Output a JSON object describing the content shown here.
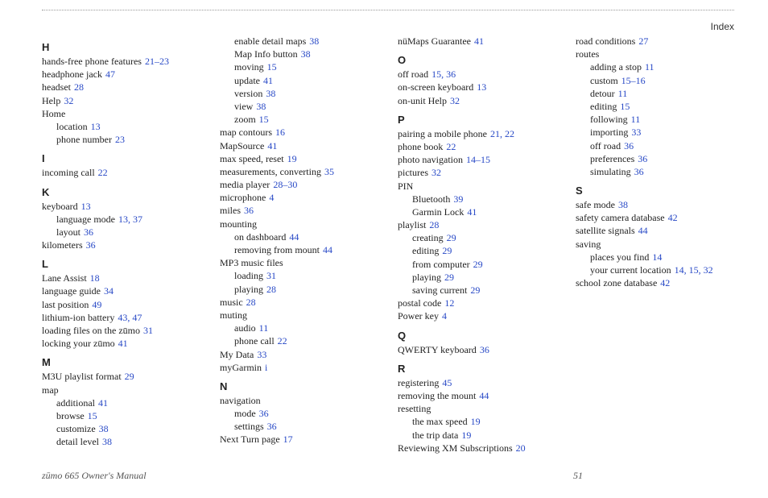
{
  "header": {
    "label": "Index"
  },
  "footer": {
    "left": "zūmo 665 Owner's Manual",
    "page_number": "51"
  },
  "index": [
    {
      "type": "letter",
      "text": "H"
    },
    {
      "type": "entry",
      "level": 0,
      "text": "hands-free phone features",
      "pages": "21–23"
    },
    {
      "type": "entry",
      "level": 0,
      "text": "headphone jack",
      "pages": "47"
    },
    {
      "type": "entry",
      "level": 0,
      "text": "headset",
      "pages": "28"
    },
    {
      "type": "entry",
      "level": 0,
      "text": "Help",
      "pages": "32"
    },
    {
      "type": "entry",
      "level": 0,
      "text": "Home",
      "pages": ""
    },
    {
      "type": "entry",
      "level": 1,
      "text": "location",
      "pages": "13"
    },
    {
      "type": "entry",
      "level": 1,
      "text": "phone number",
      "pages": "23"
    },
    {
      "type": "letter",
      "text": "I"
    },
    {
      "type": "entry",
      "level": 0,
      "text": "incoming call",
      "pages": "22"
    },
    {
      "type": "letter",
      "text": "K"
    },
    {
      "type": "entry",
      "level": 0,
      "text": "keyboard",
      "pages": "13"
    },
    {
      "type": "entry",
      "level": 1,
      "text": "language mode",
      "pages": "13, 37"
    },
    {
      "type": "entry",
      "level": 1,
      "text": "layout",
      "pages": "36"
    },
    {
      "type": "entry",
      "level": 0,
      "text": "kilometers",
      "pages": "36"
    },
    {
      "type": "letter",
      "text": "L"
    },
    {
      "type": "entry",
      "level": 0,
      "text": "Lane Assist",
      "pages": "18"
    },
    {
      "type": "entry",
      "level": 0,
      "text": "language guide",
      "pages": "34"
    },
    {
      "type": "entry",
      "level": 0,
      "text": "last position",
      "pages": "49"
    },
    {
      "type": "entry",
      "level": 0,
      "text": "lithium-ion battery",
      "pages": "43, 47"
    },
    {
      "type": "entry",
      "level": 0,
      "text": "loading files on the zūmo",
      "pages": "31"
    },
    {
      "type": "entry",
      "level": 0,
      "text": "locking your zūmo",
      "pages": "41"
    },
    {
      "type": "letter",
      "text": "M"
    },
    {
      "type": "entry",
      "level": 0,
      "text": "M3U playlist format",
      "pages": "29"
    },
    {
      "type": "entry",
      "level": 0,
      "text": "map",
      "pages": ""
    },
    {
      "type": "entry",
      "level": 1,
      "text": "additional",
      "pages": "41"
    },
    {
      "type": "entry",
      "level": 1,
      "text": "browse",
      "pages": "15"
    },
    {
      "type": "entry",
      "level": 1,
      "text": "customize",
      "pages": "38"
    },
    {
      "type": "entry",
      "level": 1,
      "text": "detail level",
      "pages": "38"
    },
    {
      "type": "entry",
      "level": 1,
      "text": "enable detail maps",
      "pages": "38"
    },
    {
      "type": "entry",
      "level": 1,
      "text": "Map Info button",
      "pages": "38"
    },
    {
      "type": "entry",
      "level": 1,
      "text": "moving",
      "pages": "15"
    },
    {
      "type": "entry",
      "level": 1,
      "text": "update",
      "pages": "41"
    },
    {
      "type": "entry",
      "level": 1,
      "text": "version",
      "pages": "38"
    },
    {
      "type": "entry",
      "level": 1,
      "text": "view",
      "pages": "38"
    },
    {
      "type": "entry",
      "level": 1,
      "text": "zoom",
      "pages": "15"
    },
    {
      "type": "entry",
      "level": 0,
      "text": "map contours",
      "pages": "16"
    },
    {
      "type": "entry",
      "level": 0,
      "text": "MapSource",
      "pages": "41"
    },
    {
      "type": "entry",
      "level": 0,
      "text": "max speed, reset",
      "pages": "19"
    },
    {
      "type": "entry",
      "level": 0,
      "text": "measurements, converting",
      "pages": "35"
    },
    {
      "type": "entry",
      "level": 0,
      "text": "media player",
      "pages": "28–30"
    },
    {
      "type": "entry",
      "level": 0,
      "text": "microphone",
      "pages": "4"
    },
    {
      "type": "entry",
      "level": 0,
      "text": "miles",
      "pages": "36"
    },
    {
      "type": "entry",
      "level": 0,
      "text": "mounting",
      "pages": ""
    },
    {
      "type": "entry",
      "level": 1,
      "text": "on dashboard",
      "pages": "44"
    },
    {
      "type": "entry",
      "level": 1,
      "text": "removing from mount",
      "pages": "44"
    },
    {
      "type": "entry",
      "level": 0,
      "text": "MP3 music files",
      "pages": ""
    },
    {
      "type": "entry",
      "level": 1,
      "text": "loading",
      "pages": "31"
    },
    {
      "type": "entry",
      "level": 1,
      "text": "playing",
      "pages": "28"
    },
    {
      "type": "entry",
      "level": 0,
      "text": "music",
      "pages": "28"
    },
    {
      "type": "entry",
      "level": 0,
      "text": "muting",
      "pages": ""
    },
    {
      "type": "entry",
      "level": 1,
      "text": "audio",
      "pages": "11"
    },
    {
      "type": "entry",
      "level": 1,
      "text": "phone call",
      "pages": "22"
    },
    {
      "type": "entry",
      "level": 0,
      "text": "My Data",
      "pages": "33"
    },
    {
      "type": "entry",
      "level": 0,
      "text": "myGarmin",
      "pages": "i"
    },
    {
      "type": "letter",
      "text": "N"
    },
    {
      "type": "entry",
      "level": 0,
      "text": "navigation",
      "pages": ""
    },
    {
      "type": "entry",
      "level": 1,
      "text": "mode",
      "pages": "36"
    },
    {
      "type": "entry",
      "level": 1,
      "text": "settings",
      "pages": "36"
    },
    {
      "type": "entry",
      "level": 0,
      "text": "Next Turn page",
      "pages": "17"
    },
    {
      "type": "entry",
      "level": 0,
      "text": "nüMaps Guarantee",
      "pages": "41"
    },
    {
      "type": "letter",
      "text": "O"
    },
    {
      "type": "entry",
      "level": 0,
      "text": "off road",
      "pages": "15, 36"
    },
    {
      "type": "entry",
      "level": 0,
      "text": "on-screen keyboard",
      "pages": "13"
    },
    {
      "type": "entry",
      "level": 0,
      "text": "on-unit Help",
      "pages": "32"
    },
    {
      "type": "letter",
      "text": "P"
    },
    {
      "type": "entry",
      "level": 0,
      "text": "pairing a mobile phone",
      "pages": "21, 22"
    },
    {
      "type": "entry",
      "level": 0,
      "text": "phone book",
      "pages": "22"
    },
    {
      "type": "entry",
      "level": 0,
      "text": "photo navigation",
      "pages": "14–15"
    },
    {
      "type": "entry",
      "level": 0,
      "text": "pictures",
      "pages": "32"
    },
    {
      "type": "entry",
      "level": 0,
      "text": "PIN",
      "pages": ""
    },
    {
      "type": "entry",
      "level": 1,
      "text": "Bluetooth",
      "pages": "39"
    },
    {
      "type": "entry",
      "level": 1,
      "text": "Garmin Lock",
      "pages": "41"
    },
    {
      "type": "entry",
      "level": 0,
      "text": "playlist",
      "pages": "28"
    },
    {
      "type": "entry",
      "level": 1,
      "text": "creating",
      "pages": "29"
    },
    {
      "type": "entry",
      "level": 1,
      "text": "editing",
      "pages": "29"
    },
    {
      "type": "entry",
      "level": 1,
      "text": "from computer",
      "pages": "29"
    },
    {
      "type": "entry",
      "level": 1,
      "text": "playing",
      "pages": "29"
    },
    {
      "type": "entry",
      "level": 1,
      "text": "saving current",
      "pages": "29"
    },
    {
      "type": "entry",
      "level": 0,
      "text": "postal code",
      "pages": "12"
    },
    {
      "type": "entry",
      "level": 0,
      "text": "Power key",
      "pages": "4"
    },
    {
      "type": "letter",
      "text": "Q"
    },
    {
      "type": "entry",
      "level": 0,
      "text": "QWERTY keyboard",
      "pages": "36"
    },
    {
      "type": "letter",
      "text": "R"
    },
    {
      "type": "entry",
      "level": 0,
      "text": "registering",
      "pages": "45"
    },
    {
      "type": "entry",
      "level": 0,
      "text": "removing the mount",
      "pages": "44"
    },
    {
      "type": "entry",
      "level": 0,
      "text": "resetting",
      "pages": ""
    },
    {
      "type": "entry",
      "level": 1,
      "text": "the max speed",
      "pages": "19"
    },
    {
      "type": "entry",
      "level": 1,
      "text": "the trip data",
      "pages": "19"
    },
    {
      "type": "entry",
      "level": 0,
      "text": "Reviewing XM Subscriptions",
      "pages": "20"
    },
    {
      "type": "entry",
      "level": 0,
      "text": "road conditions",
      "pages": "27"
    },
    {
      "type": "entry",
      "level": 0,
      "text": "routes",
      "pages": ""
    },
    {
      "type": "entry",
      "level": 1,
      "text": "adding a stop",
      "pages": "11"
    },
    {
      "type": "entry",
      "level": 1,
      "text": "custom",
      "pages": "15–16"
    },
    {
      "type": "entry",
      "level": 1,
      "text": "detour",
      "pages": "11"
    },
    {
      "type": "entry",
      "level": 1,
      "text": "editing",
      "pages": "15"
    },
    {
      "type": "entry",
      "level": 1,
      "text": "following",
      "pages": "11"
    },
    {
      "type": "entry",
      "level": 1,
      "text": "importing",
      "pages": "33"
    },
    {
      "type": "entry",
      "level": 1,
      "text": "off road",
      "pages": "36"
    },
    {
      "type": "entry",
      "level": 1,
      "text": "preferences",
      "pages": "36"
    },
    {
      "type": "entry",
      "level": 1,
      "text": "simulating",
      "pages": "36"
    },
    {
      "type": "letter",
      "text": "S"
    },
    {
      "type": "entry",
      "level": 0,
      "text": "safe mode",
      "pages": "38"
    },
    {
      "type": "entry",
      "level": 0,
      "text": "safety camera database",
      "pages": "42"
    },
    {
      "type": "entry",
      "level": 0,
      "text": "satellite signals",
      "pages": "44"
    },
    {
      "type": "entry",
      "level": 0,
      "text": "saving",
      "pages": ""
    },
    {
      "type": "entry",
      "level": 1,
      "text": "places you find",
      "pages": "14"
    },
    {
      "type": "entry",
      "level": 1,
      "text": "your current location",
      "pages": "14, 15, 32"
    },
    {
      "type": "entry",
      "level": 0,
      "text": "school zone database",
      "pages": "42"
    }
  ]
}
